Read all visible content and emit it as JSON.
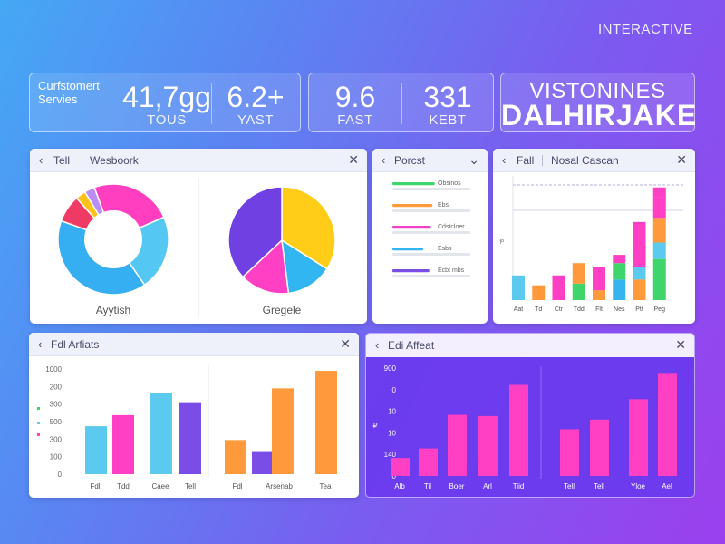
{
  "header": {
    "tag": "INTERACTIVE"
  },
  "stats": {
    "card1": {
      "title_line1": "Curfstomert",
      "title_line2": "Servies",
      "metrics": [
        {
          "value": "41,7gg",
          "label": "TOUS"
        },
        {
          "value": "6.2+",
          "label": "YAST"
        }
      ]
    },
    "card2": {
      "metrics": [
        {
          "value": "9.6",
          "label": "FAST"
        },
        {
          "value": "331",
          "label": "KEBT"
        }
      ]
    },
    "brand": {
      "subtitle": "VISTONINES",
      "title": "DALHIRJAKE"
    }
  },
  "panels": {
    "pies": {
      "title": "Tell",
      "subtitle": "Wesboork",
      "chart_data": [
        {
          "type": "pie",
          "variant": "donut",
          "label": "Ayytish",
          "slices": [
            {
              "value": 24,
              "color": "#ff3fbf"
            },
            {
              "value": 22,
              "color": "#54c8f2"
            },
            {
              "value": 40,
              "color": "#35aef2"
            },
            {
              "value": 8,
              "color": "#f03a66"
            },
            {
              "value": 3,
              "color": "#ffc21a"
            },
            {
              "value": 3,
              "color": "#b98df5"
            }
          ]
        },
        {
          "type": "pie",
          "label": "Gregele",
          "slices": [
            {
              "value": 34,
              "color": "#ffcc17"
            },
            {
              "value": 14,
              "color": "#32b6f2"
            },
            {
              "value": 15,
              "color": "#ff3fc4"
            },
            {
              "value": 37,
              "color": "#7140e2"
            }
          ]
        }
      ]
    },
    "forecast": {
      "title": "Porcst",
      "chart_data": {
        "type": "bar",
        "orientation": "horizontal",
        "items": [
          {
            "label": "Obsinos",
            "value": 0.55,
            "color": "#3ed66a"
          },
          {
            "label": "Ebs",
            "value": 0.52,
            "color": "#ff9a3c"
          },
          {
            "label": "Cdstcloer",
            "value": 0.5,
            "color": "#f040c8"
          },
          {
            "label": "Esbs",
            "value": 0.4,
            "color": "#35b5ee"
          },
          {
            "label": "Ecbt mbs",
            "value": 0.48,
            "color": "#7a4de6"
          }
        ]
      }
    },
    "stacked": {
      "title": "Fall",
      "subtitle": "Nosal Cascan",
      "chart_data": {
        "type": "bar",
        "stacked": true,
        "categories": [
          "Aat",
          "Td",
          "Ctr",
          "Tdd",
          "Flt",
          "Nes",
          "Ptt",
          "Peg"
        ],
        "stacks": [
          [
            {
              "value": 30,
              "color": "#5cc9ee"
            }
          ],
          [
            {
              "value": 18,
              "color": "#ff9a3c"
            }
          ],
          [
            {
              "value": 30,
              "color": "#ff3fc4"
            }
          ],
          [
            {
              "value": 20,
              "color": "#3ed66a"
            },
            {
              "value": 25,
              "color": "#ff9a3c"
            }
          ],
          [
            {
              "value": 12,
              "color": "#ff9a3c"
            },
            {
              "value": 28,
              "color": "#ff3fc4"
            }
          ],
          [
            {
              "value": 25,
              "color": "#35b5ee"
            },
            {
              "value": 20,
              "color": "#3ed66a"
            },
            {
              "value": 10,
              "color": "#ff3fc4"
            }
          ],
          [
            {
              "value": 25,
              "color": "#ff9a3c"
            },
            {
              "value": 15,
              "color": "#5cc9ee"
            },
            {
              "value": 55,
              "color": "#ff3fc4"
            }
          ],
          [
            {
              "value": 50,
              "color": "#3ed66a"
            },
            {
              "value": 20,
              "color": "#5cc9ee"
            },
            {
              "value": 30,
              "color": "#ff9a3c"
            },
            {
              "value": 25,
              "color": "#ff3fc4"
            },
            {
              "value": 12,
              "color": "#ff3fc4"
            }
          ]
        ]
      }
    },
    "artists": {
      "title": "Fdl Arfiats",
      "chart_data": {
        "type": "bar",
        "ylim": [
          0,
          1000
        ],
        "yticks": [
          "0",
          "100",
          "300",
          "500",
          "300",
          "200",
          "1000"
        ],
        "groups": [
          {
            "label": "Fdl",
            "bars": [
              {
                "value": 520,
                "color": "#5cc9ee"
              },
              {
                "value": 640,
                "color": "#ff3fc4"
              }
            ]
          },
          {
            "label": "Tdd",
            "bars": []
          },
          {
            "label": "Caee",
            "bars": [
              {
                "value": 880,
                "color": "#5cc9ee"
              }
            ]
          },
          {
            "label": "Tell",
            "bars": [
              {
                "value": 780,
                "color": "#7a4de6"
              }
            ]
          },
          {
            "label": "Fdl",
            "bars": [
              {
                "value": 370,
                "color": "#ff9a3c"
              },
              {
                "value": 250,
                "color": "#7a4de6"
              }
            ]
          },
          {
            "label": "Arsenab",
            "bars": [
              {
                "value": 930,
                "color": "#ff9a3c"
              }
            ]
          },
          {
            "label": "Tea",
            "bars": [
              {
                "value": 1120,
                "color": "#ff9a3c"
              }
            ]
          }
        ]
      }
    },
    "affect": {
      "title": "Edi Affeat",
      "chart_data": {
        "type": "bar",
        "ylim": [
          0,
          900
        ],
        "yticks": [
          "0",
          "140",
          "10",
          "10",
          "0",
          "900"
        ],
        "categories": [
          "Alb",
          "Til",
          "Boer",
          "Arl",
          "Tiid",
          "Tell",
          "Tell",
          "Yloe",
          "Ael"
        ],
        "values": [
          150,
          230,
          510,
          500,
          760,
          390,
          470,
          640,
          860
        ],
        "color": "#ff3fc4"
      }
    }
  }
}
